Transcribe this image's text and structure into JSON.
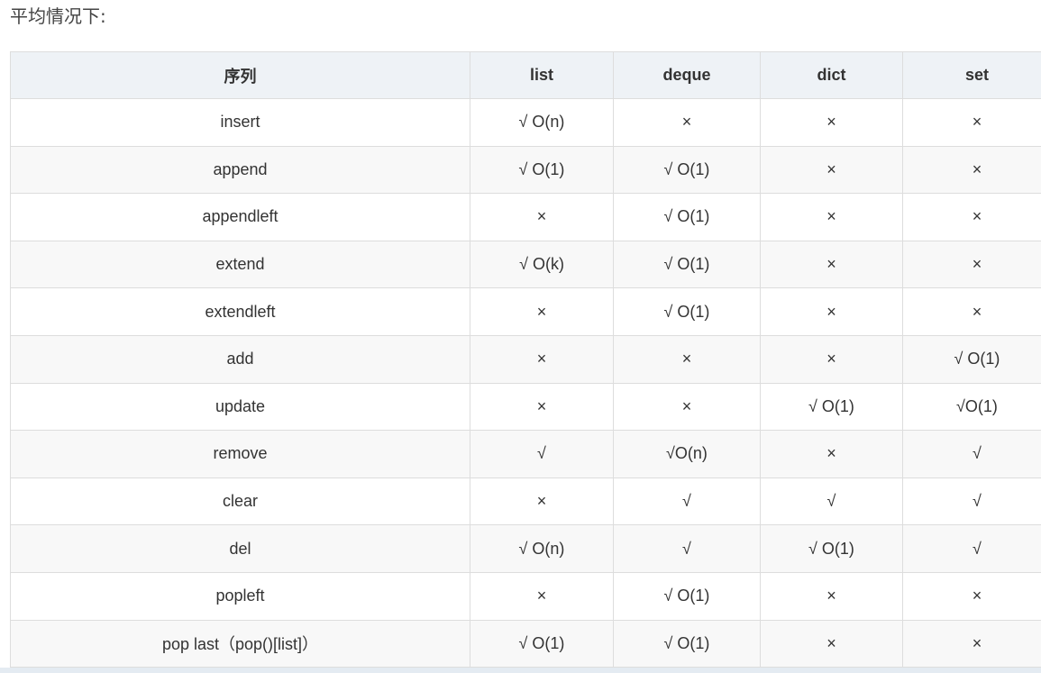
{
  "heading": "平均情况下:",
  "table": {
    "headers": [
      "序列",
      "list",
      "deque",
      "dict",
      "set"
    ],
    "rows": [
      [
        "insert",
        "√ O(n)",
        "×",
        "×",
        "×"
      ],
      [
        "append",
        "√ O(1)",
        "√ O(1)",
        "×",
        "×"
      ],
      [
        "appendleft",
        "×",
        "√ O(1)",
        "×",
        "×"
      ],
      [
        "extend",
        "√ O(k)",
        "√ O(1)",
        "×",
        "×"
      ],
      [
        "extendleft",
        "×",
        "√ O(1)",
        "×",
        "×"
      ],
      [
        "add",
        "×",
        "×",
        "×",
        "√ O(1)"
      ],
      [
        "update",
        "×",
        "×",
        "√ O(1)",
        "√O(1)"
      ],
      [
        "remove",
        "√",
        "√O(n)",
        "×",
        "√"
      ],
      [
        "clear",
        "×",
        "√",
        "√",
        "√"
      ],
      [
        "del",
        "√ O(n)",
        "√",
        "√ O(1)",
        "√"
      ],
      [
        "popleft",
        "×",
        "√ O(1)",
        "×",
        "×"
      ],
      [
        "pop last（pop()[list]）",
        "√ O(1)",
        "√ O(1)",
        "×",
        "×"
      ]
    ]
  }
}
